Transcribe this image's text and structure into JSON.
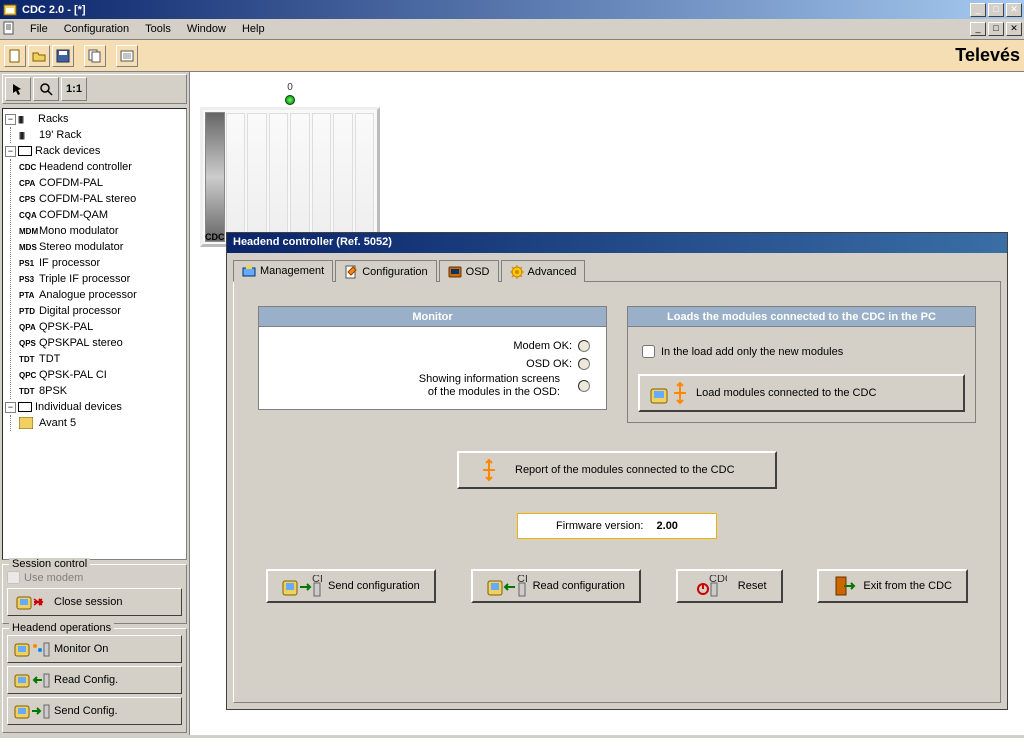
{
  "window": {
    "title": "CDC 2.0 - [*]",
    "minimize": "_",
    "maximize": "□",
    "close": "✕"
  },
  "menu": {
    "file": "File",
    "configuration": "Configuration",
    "tools": "Tools",
    "window": "Window",
    "help": "Help"
  },
  "brand": "Televés",
  "tree": {
    "racks": "Racks",
    "rack_19": "19' Rack",
    "rack_devices": "Rack devices",
    "items": [
      {
        "code": "CDC",
        "label": "Headend controller"
      },
      {
        "code": "CPA",
        "label": "COFDM-PAL"
      },
      {
        "code": "CPS",
        "label": "COFDM-PAL stereo"
      },
      {
        "code": "CQA",
        "label": "COFDM-QAM"
      },
      {
        "code": "MDM",
        "label": "Mono modulator"
      },
      {
        "code": "MDS",
        "label": "Stereo modulator"
      },
      {
        "code": "PS1",
        "label": "IF processor"
      },
      {
        "code": "PS3",
        "label": "Triple IF processor"
      },
      {
        "code": "PTA",
        "label": "Analogue processor"
      },
      {
        "code": "PTD",
        "label": "Digital processor"
      },
      {
        "code": "QPA",
        "label": "QPSK-PAL"
      },
      {
        "code": "QPS",
        "label": "QPSKPAL stereo"
      },
      {
        "code": "TDT",
        "label": "TDT"
      },
      {
        "code": "QPC",
        "label": "QPSK-PAL CI"
      },
      {
        "code": "TDT",
        "label": "8PSK"
      }
    ],
    "individual": "Individual devices",
    "avant": "Avant 5"
  },
  "session": {
    "title": "Session control",
    "use_modem": "Use modem",
    "close": "Close session"
  },
  "headend_ops": {
    "title": "Headend operations",
    "monitor": "Monitor On",
    "read": "Read Config.",
    "send": "Send Config."
  },
  "rack": {
    "slot_label": "0",
    "tag": "CDC"
  },
  "dialog": {
    "title": "Headend controller (Ref. 5052)",
    "tabs": {
      "management": "Management",
      "configuration": "Configuration",
      "osd": "OSD",
      "advanced": "Advanced"
    },
    "monitor": {
      "header": "Monitor",
      "modem": "Modem OK:",
      "osd": "OSD OK:",
      "info1": "Showing information screens",
      "info2": "of the modules in the OSD:"
    },
    "loads": {
      "header": "Loads the modules connected to the CDC in the PC",
      "check": "In the load add only the new modules",
      "button": "Load modules connected to the CDC"
    },
    "report": "Report of the modules connected to the CDC",
    "firmware_label": "Firmware version:",
    "firmware_value": "2.00",
    "buttons": {
      "send": "Send configuration",
      "read": "Read configuration",
      "reset": "Reset",
      "exit": "Exit from the CDC"
    }
  }
}
